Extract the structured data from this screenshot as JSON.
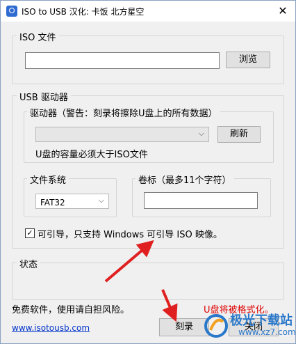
{
  "window": {
    "title": "ISO to USB  汉化: 卡饭 北方星空",
    "close_glyph": "✕"
  },
  "iso_group": {
    "legend": "ISO 文件",
    "path_value": "",
    "browse_label": "浏览"
  },
  "usb_group": {
    "legend": "USB 驱动器",
    "drive_legend": "驱动器（警告：刻录将擦除U盘上的所有数据）",
    "drive_value": "",
    "refresh_label": "刷新",
    "capacity_note": "U盘的容量必须大于ISO文件",
    "fs_legend": "文件系统",
    "fs_value": "FAT32",
    "label_legend": "卷标（最多11个字符）",
    "label_value": "",
    "bootable_checked": true,
    "bootable_text": "可引导，只支持 Windows 可引导 ISO 映像。"
  },
  "status_group": {
    "legend": "状态",
    "text": ""
  },
  "footer": {
    "disclaimer": "免费软件，使用请自担风险。",
    "format_warning": "U盘将被格式化。",
    "website": "www.isotousb.com",
    "burn_label": "刻录",
    "close_label": "关闭"
  },
  "watermark": {
    "text": "极光下载站",
    "url": "www.xz7.com"
  },
  "colors": {
    "annotation_arrow": "#e02020",
    "warning": "#e00000",
    "link": "#0033cc"
  }
}
